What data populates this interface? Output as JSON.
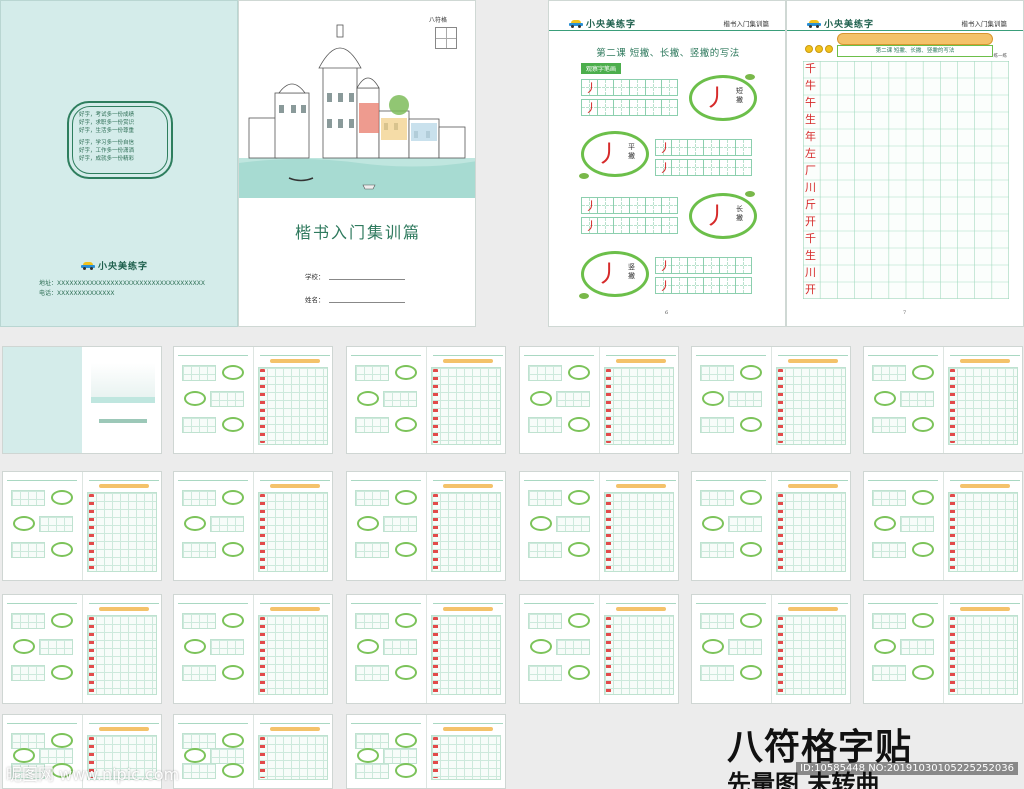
{
  "cover": {
    "back": {
      "mottos": [
        "好字，考试多一份成绩",
        "好字，求职多一份赏识",
        "好字，生活多一份尊重",
        "好字，学习多一份自信",
        "好字，工作多一份潇洒",
        "好字，成就多一份精彩"
      ],
      "brand": "小央美练字",
      "address": "地址：XXXXXXXXXXXXXXXXXXXXXXXXXXXXXXXXXXXX",
      "phone": "电话：XXXXXXXXXXXXXX"
    },
    "front": {
      "mark": "八符格",
      "title": "楷书入门集训篇",
      "school_label": "学校：",
      "name_label": "姓名："
    }
  },
  "lesson": {
    "brand": "小央美练字",
    "book": "楷书入门集训篇",
    "title": "第二课  短撇、长撇、竖撇的写法",
    "observe_tag": "观察字笔画",
    "badges": [
      {
        "glyph": "丿",
        "label": "短撇"
      },
      {
        "glyph": "丿",
        "label": "平撇"
      },
      {
        "glyph": "丿",
        "label": "长撇"
      },
      {
        "glyph": "丿",
        "label": "竖撇"
      }
    ],
    "stroke": "丿",
    "page_left": "6",
    "page_right": "7",
    "p7_title": "第二课  短撇、长撇、竖撇的写法",
    "practice_label": "练一练",
    "chars": [
      "千",
      "牛",
      "午",
      "生",
      "年",
      "左",
      "厂",
      "川",
      "斤",
      "开",
      "千",
      "生",
      "川",
      "开"
    ]
  },
  "promo": {
    "line1": "八符格字贴",
    "line2": "先量图 未转曲"
  },
  "watermark": {
    "left": "昵图网 www.nipic.com",
    "right": "ID:10585448 NO:20191030105225252036"
  }
}
